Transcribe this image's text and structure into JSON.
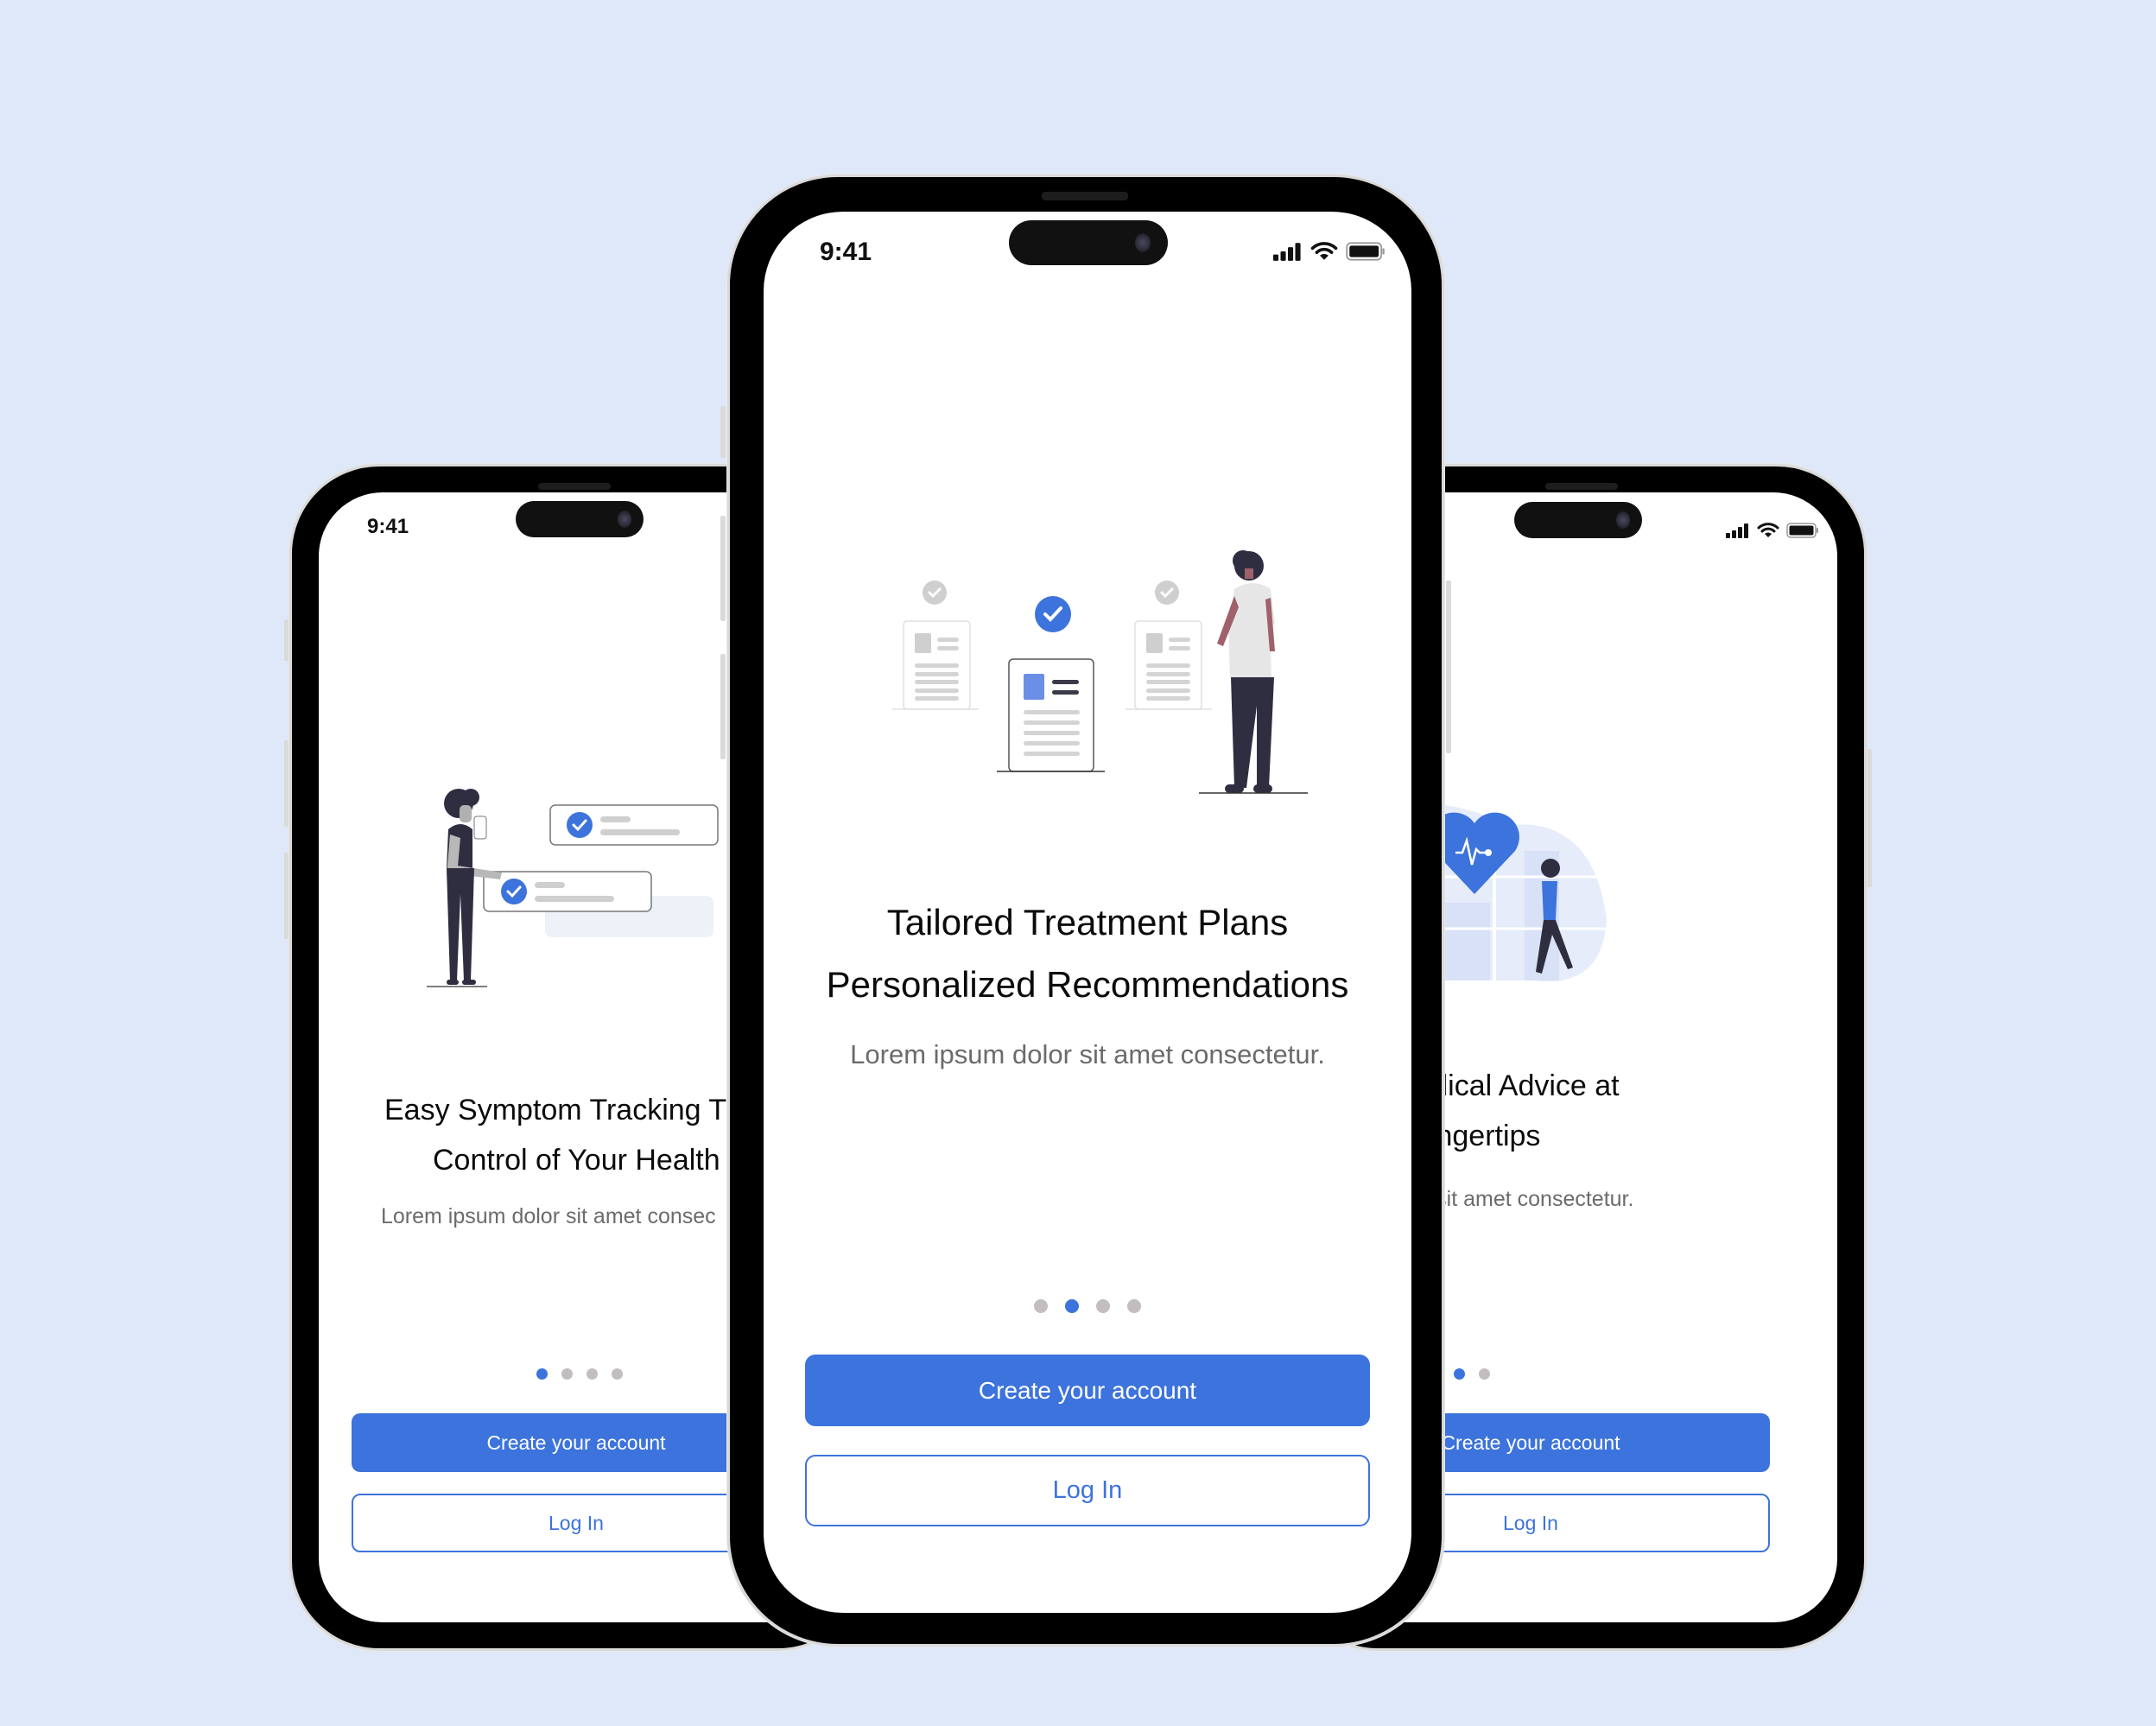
{
  "colors": {
    "background": "#DFE8F8",
    "accent": "#3D73DC",
    "dot_inactive": "#C2BEBE",
    "title": "#0B0B0B",
    "subtitle": "#6B6B6B"
  },
  "phones": [
    {
      "position": "left",
      "status_bar": {
        "time": "9:41"
      },
      "illustration": "symptom-tracking-illustration",
      "title_line1": "Easy Symptom Tracking T",
      "title_line2": "Control of Your Health",
      "subtitle": "Lorem ipsum dolor sit amet consec",
      "pagination": {
        "total": 4,
        "active_index": 0
      },
      "primary_button": "Create your account",
      "secondary_button": "Log In"
    },
    {
      "position": "center",
      "status_bar": {
        "time": "9:41"
      },
      "illustration": "treatment-plans-illustration",
      "title_line1": "Tailored Treatment Plans",
      "title_line2": "Personalized Recommendations",
      "subtitle": "Lorem ipsum dolor sit amet consectetur.",
      "pagination": {
        "total": 4,
        "active_index": 1
      },
      "primary_button": "Create your account",
      "secondary_button": "Log In"
    },
    {
      "position": "right",
      "status_bar": {
        "time": ""
      },
      "illustration": "medical-advice-illustration",
      "title_line1": "xpert Medical Advice at",
      "title_line2": "Your Fingertips",
      "subtitle": "ipsum dolor sit amet consectetur.",
      "pagination": {
        "total": 4,
        "active_index": 2
      },
      "primary_button": "Create your account",
      "secondary_button": "Log In"
    }
  ]
}
